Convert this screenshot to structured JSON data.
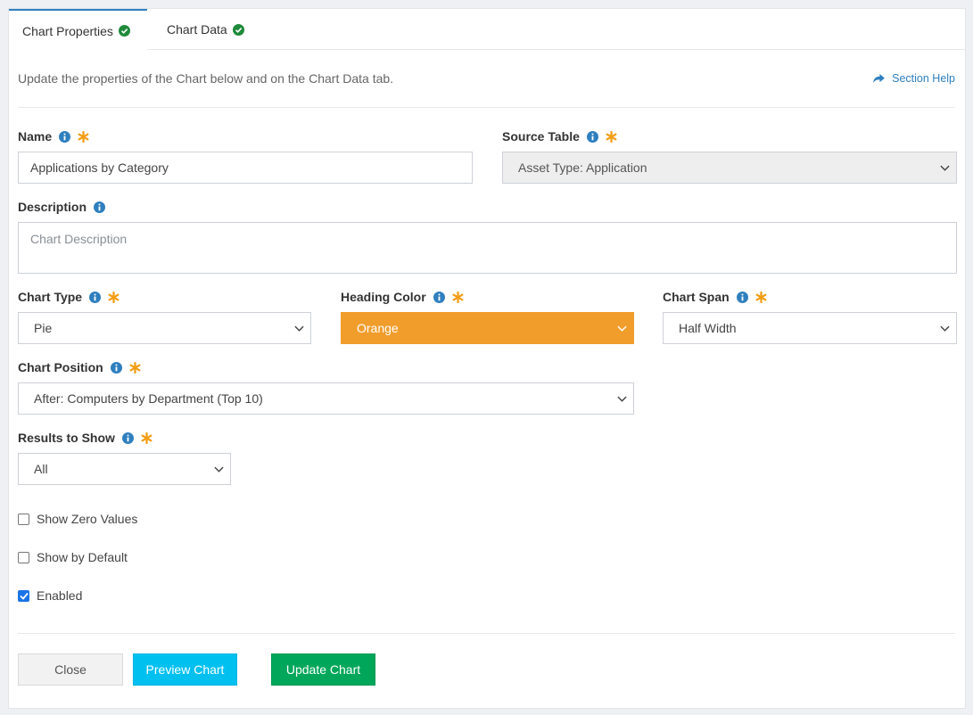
{
  "tabs": [
    {
      "label": "Chart Properties",
      "status_icon": "check-circle-icon"
    },
    {
      "label": "Chart Data",
      "status_icon": "check-circle-icon"
    }
  ],
  "intro_text": "Update the properties of the Chart below and on the Chart Data tab.",
  "section_help": "Section Help",
  "fields": {
    "name": {
      "label": "Name",
      "value": "Applications by Category"
    },
    "source_table": {
      "label": "Source Table",
      "value": "Asset Type: Application"
    },
    "description": {
      "label": "Description",
      "value": "",
      "placeholder": "Chart Description"
    },
    "chart_type": {
      "label": "Chart Type",
      "value": "Pie"
    },
    "heading_color": {
      "label": "Heading Color",
      "value": "Orange",
      "color": "#f09d2c"
    },
    "chart_span": {
      "label": "Chart Span",
      "value": "Half Width"
    },
    "chart_position": {
      "label": "Chart Position",
      "value": "After: Computers by Department (Top 10)"
    },
    "results_to_show": {
      "label": "Results to Show",
      "value": "All"
    }
  },
  "checkboxes": [
    {
      "label": "Show Zero Values",
      "checked": false
    },
    {
      "label": "Show by Default",
      "checked": false
    },
    {
      "label": "Enabled",
      "checked": true
    }
  ],
  "buttons": {
    "close": "Close",
    "preview": "Preview Chart",
    "update": "Update Chart"
  },
  "colors": {
    "accent": "#2f7fbf",
    "required_star": "#f39c12",
    "success": "#00a65a",
    "info": "#00c0ef"
  }
}
